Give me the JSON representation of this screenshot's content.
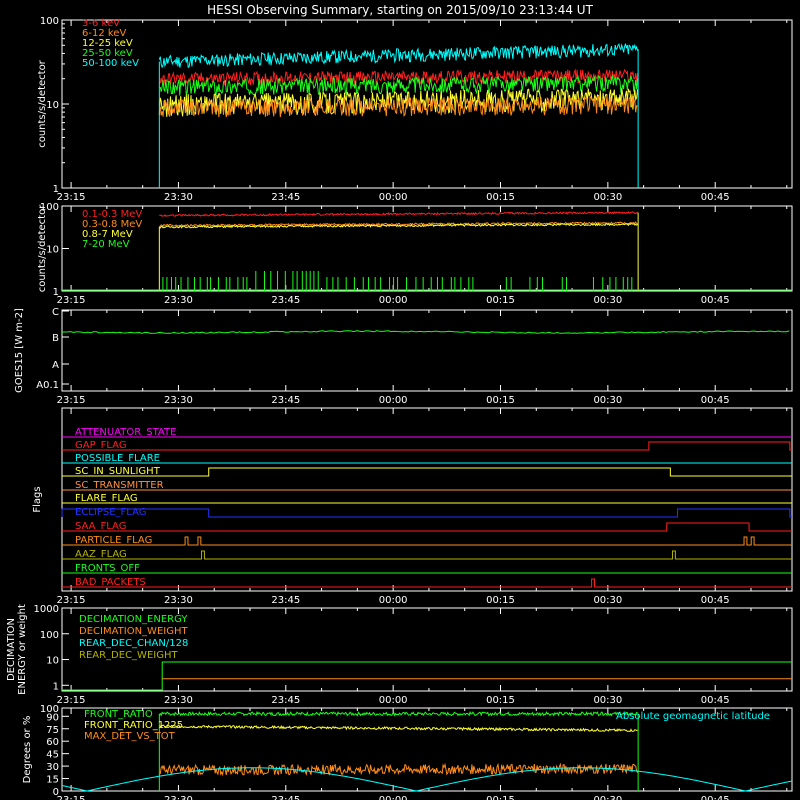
{
  "title": "HESSI Observing Summary, starting on 2015/09/10 23:13:44 UT",
  "time_ticks": [
    "23:15",
    "23:30",
    "23:45",
    "00:00",
    "00:15",
    "00:30",
    "00:45"
  ],
  "colors": {
    "red": "#ff2020",
    "orange": "#ff8c1a",
    "yellow": "#ffff33",
    "green": "#19ff19",
    "cyan": "#00ffff",
    "magenta": "#ff00ff",
    "blue": "#2233ff",
    "olive": "#b4b400",
    "salmon": "#ff9040",
    "grey": "#e6e6e6"
  },
  "chart_data": [
    {
      "id": "xray",
      "type": "line",
      "ylabel": "counts/s/detector",
      "y_scale": "log",
      "ylim": [
        1,
        100
      ],
      "ytick_labels": [
        "1",
        "10",
        "100"
      ],
      "data_window_minutes": [
        13.6,
        80.5
      ],
      "series": [
        {
          "name": "3-6 keV",
          "color": "#ff2020",
          "start": 20,
          "end": 22,
          "noise": 0.18
        },
        {
          "name": "6-12 keV",
          "color": "#ff8c1a",
          "start": 9,
          "end": 10,
          "noise": 0.25
        },
        {
          "name": "12-25 keV",
          "color": "#ffff33",
          "start": 10,
          "end": 12,
          "noise": 0.3
        },
        {
          "name": "25-50 keV",
          "color": "#19ff19",
          "start": 16,
          "end": 18,
          "noise": 0.22
        },
        {
          "name": "50-100 keV",
          "color": "#00ffff",
          "start": 32,
          "end": 45,
          "noise": 0.18
        }
      ]
    },
    {
      "id": "gamma",
      "type": "line",
      "ylabel": "counts/s/detector",
      "y_scale": "log",
      "ylim": [
        1,
        100
      ],
      "ytick_labels": [
        "1",
        "10",
        "100"
      ],
      "data_window_minutes": [
        13.6,
        80.5
      ],
      "series": [
        {
          "name": "0.1-0.3 MeV",
          "color": "#ff2020",
          "start": 60,
          "end": 70,
          "noise": 0.05
        },
        {
          "name": "0.3-0.8 MeV",
          "color": "#ff8c1a",
          "start": 35,
          "end": 40,
          "noise": 0.05
        },
        {
          "name": "0.8-7 MeV",
          "color": "#ffff33",
          "start": 32,
          "end": 37,
          "noise": 0.05
        },
        {
          "name": "7-20 MeV",
          "color": "#19ff19",
          "start": 1,
          "end": 1,
          "noise": 0
        }
      ]
    },
    {
      "id": "goes",
      "type": "line",
      "ylabel": "GOES15 [W m-2]",
      "ytick_labels": [
        "A0.1",
        "A",
        "B",
        "C"
      ],
      "series": [
        {
          "name": "GOES15",
          "color": "#19ff19",
          "level": "B"
        }
      ]
    },
    {
      "id": "flags",
      "type": "line",
      "ylabel": "Flags",
      "series": [
        {
          "name": "ATTENUATOR_STATE",
          "color": "#ff00ff"
        },
        {
          "name": "GAP_FLAG",
          "color": "#ff2020"
        },
        {
          "name": "POSSIBLE_FLARE",
          "color": "#00ffff"
        },
        {
          "name": "SC_IN_SUNLIGHT",
          "color": "#ffff33"
        },
        {
          "name": "SC_TRANSMITTER",
          "color": "#ff9040"
        },
        {
          "name": "FLARE_FLAG",
          "color": "#ffff33"
        },
        {
          "name": "ECLIPSE_FLAG",
          "color": "#2233ff"
        },
        {
          "name": "SAA_FLAG",
          "color": "#ff2020"
        },
        {
          "name": "PARTICLE_FLAG",
          "color": "#ff8c1a"
        },
        {
          "name": "AAZ_FLAG",
          "color": "#b4b400"
        },
        {
          "name": "FRONTS_OFF",
          "color": "#19ff19"
        },
        {
          "name": "BAD_PACKETS",
          "color": "#ff2020"
        }
      ]
    },
    {
      "id": "decimation",
      "type": "line",
      "ylabel": "DECIMATION ENERGY or weight",
      "y_scale": "log",
      "ylim": [
        0.6,
        1000
      ],
      "ytick_labels": [
        "1",
        "10",
        "100",
        "1000"
      ],
      "series": [
        {
          "name": "DECIMATION_ENERGY",
          "color": "#19ff19",
          "value": 8
        },
        {
          "name": "DECIMATION_WEIGHT",
          "color": "#ff8c1a",
          "value": 1.8
        },
        {
          "name": "REAR_DEC_CHAN/128",
          "color": "#00ffff",
          "value": 0
        },
        {
          "name": "REAR_DEC_WEIGHT",
          "color": "#b4b400",
          "value": 0
        }
      ]
    },
    {
      "id": "ratios",
      "type": "line",
      "ylabel": "Degrees or %",
      "ylim": [
        0,
        100
      ],
      "ytick_labels": [
        "0",
        "15",
        "30",
        "45",
        "60",
        "75",
        "90",
        "100"
      ],
      "annotation": "Absolute geomagnetic latitude",
      "data_window_minutes": [
        13.6,
        80.5
      ],
      "series": [
        {
          "name": "FRONT_RATIO",
          "color": "#19ff19",
          "start": 93,
          "end": 93,
          "noise": 2
        },
        {
          "name": "FRONT_RATIO_1225",
          "color": "#ffff33",
          "start": 78,
          "end": 73,
          "noise": 1.5
        },
        {
          "name": "MAX_DET_VS_TOT",
          "color": "#ff8c1a",
          "start": 25,
          "end": 27,
          "noise": 6
        },
        {
          "name": "Absolute geomagnetic latitude",
          "color": "#00ffff"
        }
      ]
    }
  ]
}
